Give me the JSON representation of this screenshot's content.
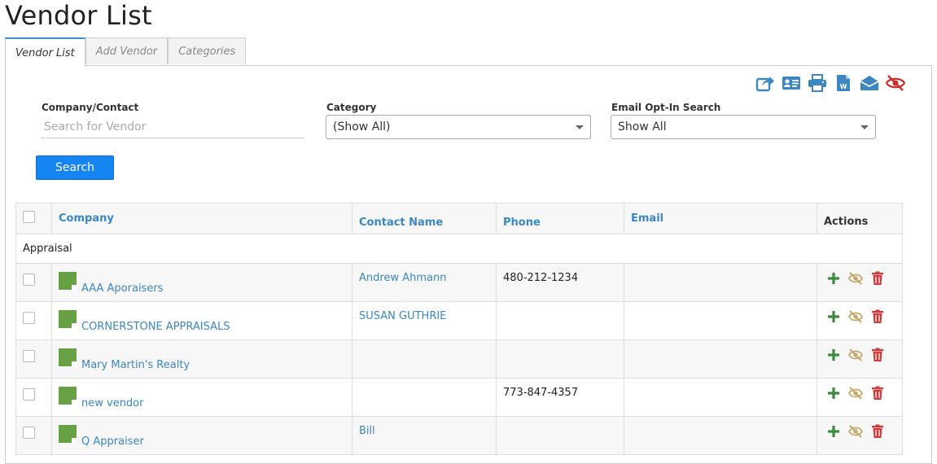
{
  "page": {
    "title": "Vendor List"
  },
  "tabs": [
    {
      "label": "Vendor List",
      "active": true
    },
    {
      "label": "Add Vendor",
      "active": false
    },
    {
      "label": "Categories",
      "active": false
    }
  ],
  "toolbar": {
    "icons": [
      "export-icon",
      "contact-card-icon",
      "print-icon",
      "word-document-icon",
      "email-icon",
      "hidden-eye-icon"
    ],
    "colors": {
      "blue": "#3b87c2",
      "red": "#c9302c"
    }
  },
  "filters": {
    "company_label": "Company/Contact",
    "company_placeholder": "Search for Vendor",
    "company_value": "",
    "category_label": "Category",
    "category_value": "(Show All)",
    "optin_label": "Email Opt-In Search",
    "optin_value": "Show All",
    "search_button": "Search"
  },
  "table": {
    "headers": {
      "company": "Company",
      "contact": "Contact Name",
      "phone": "Phone",
      "email": "Email",
      "actions": "Actions"
    },
    "group": "Appraisal",
    "rows": [
      {
        "company": "AAA Aporaisers",
        "contact": "Andrew Ahmann",
        "phone": "480-212-1234",
        "email": ""
      },
      {
        "company": "CORNERSTONE APPRAISALS",
        "contact": "SUSAN GUTHRIE",
        "phone": "",
        "email": ""
      },
      {
        "company": "Mary Martin's Realty",
        "contact": "",
        "phone": "",
        "email": ""
      },
      {
        "company": "new vendor",
        "contact": "",
        "phone": "773-847-4357",
        "email": ""
      },
      {
        "company": "Q Appraiser",
        "contact": "Bill",
        "phone": "",
        "email": ""
      }
    ],
    "colors": {
      "add": "#3c8b3c",
      "hide": "#c5a86b",
      "delete": "#d2393b",
      "note": "#66a244"
    }
  }
}
